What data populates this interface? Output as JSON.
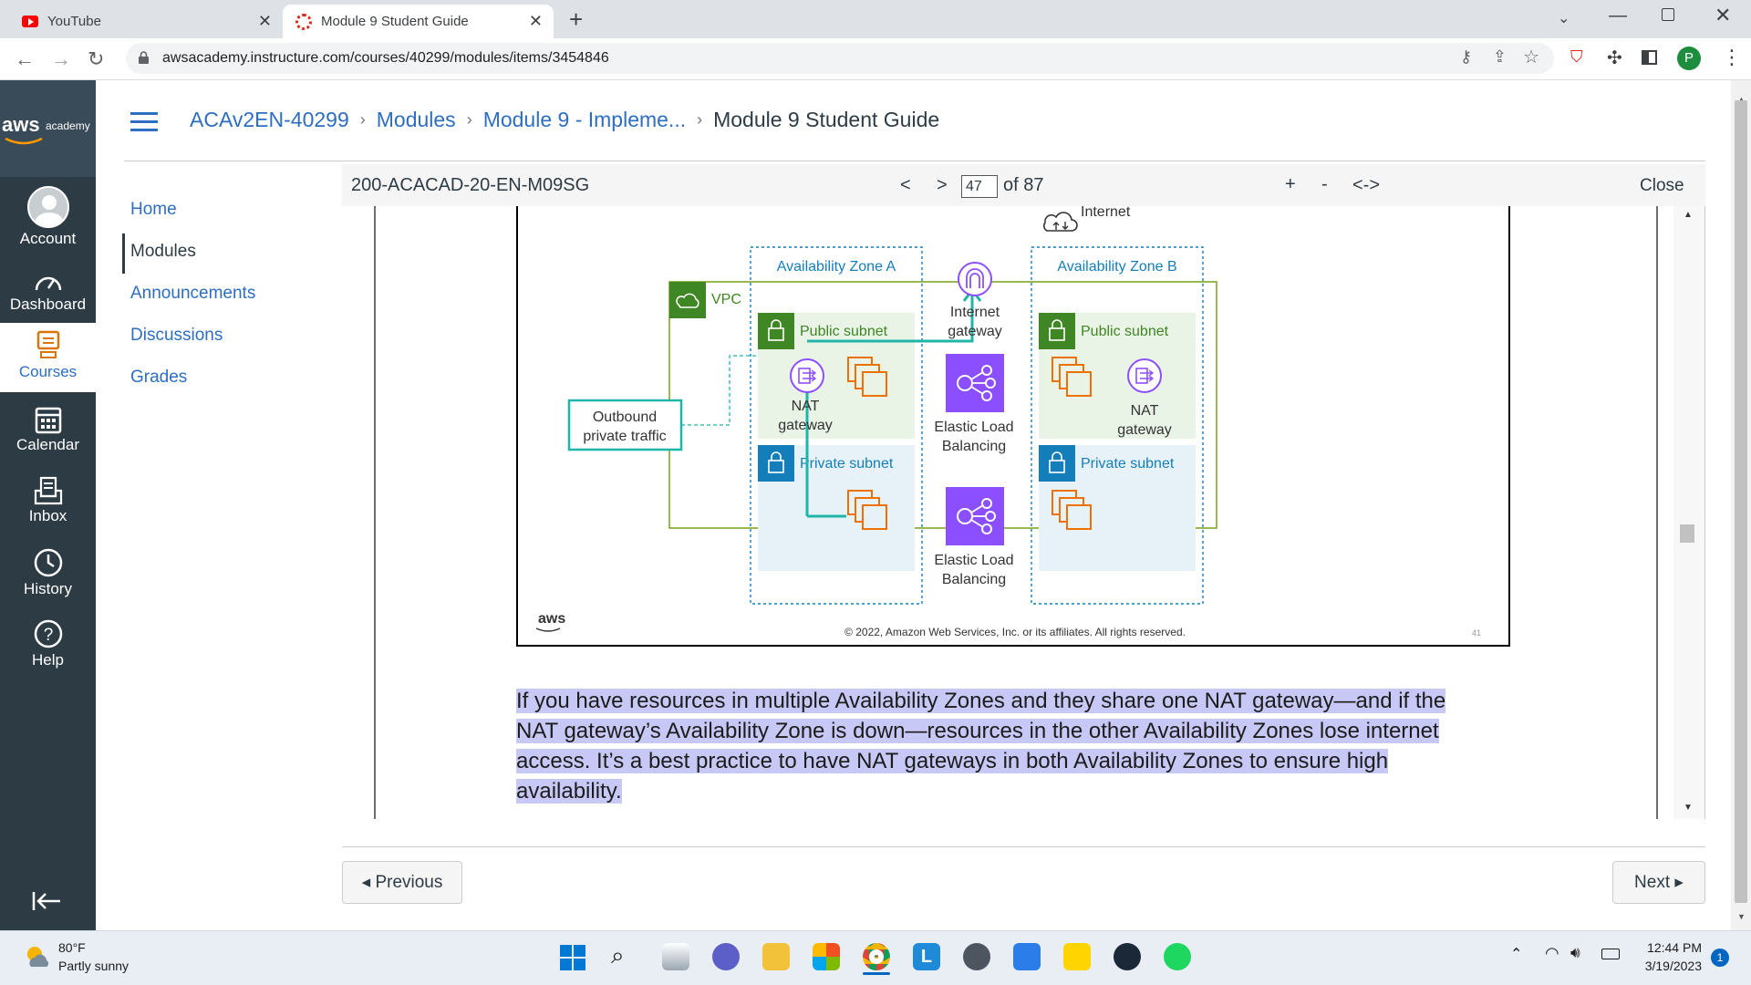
{
  "browser": {
    "tabs": [
      {
        "title": "YouTube",
        "active": false
      },
      {
        "title": "Module 9 Student Guide",
        "active": true
      }
    ],
    "url": "awsacademy.instructure.com/courses/40299/modules/items/3454846",
    "profile_initial": "P"
  },
  "global_nav": {
    "logo_text": "aws",
    "logo_sub": "academy",
    "items": [
      {
        "label": "Account",
        "icon": "account-icon"
      },
      {
        "label": "Dashboard",
        "icon": "dashboard-icon"
      },
      {
        "label": "Courses",
        "icon": "courses-icon"
      },
      {
        "label": "Calendar",
        "icon": "calendar-icon"
      },
      {
        "label": "Inbox",
        "icon": "inbox-icon"
      },
      {
        "label": "History",
        "icon": "history-icon"
      },
      {
        "label": "Help",
        "icon": "help-icon"
      }
    ]
  },
  "breadcrumb": [
    "ACAv2EN-40299",
    "Modules",
    "Module 9 - Impleme...",
    "Module 9 Student Guide"
  ],
  "course_nav": [
    "Home",
    "Modules",
    "Announcements",
    "Discussions",
    "Grades"
  ],
  "viewer": {
    "doc_id": "200-ACACAD-20-EN-M09SG",
    "prev": "<",
    "next": ">",
    "page": "47",
    "of_total": "of 87",
    "zoom_in": "+",
    "zoom_out": "-",
    "fit": "<->",
    "close": "Close"
  },
  "diagram": {
    "internet": "Internet",
    "vpc": "VPC",
    "az_a": "Availability Zone A",
    "az_b": "Availability Zone B",
    "internet_gateway": [
      "Internet",
      "gateway"
    ],
    "public_subnet": "Public subnet",
    "private_subnet": "Private subnet",
    "nat_gateway": [
      "NAT",
      "gateway"
    ],
    "elb": [
      "Elastic Load",
      "Balancing"
    ],
    "outbound": [
      "Outbound",
      "private traffic"
    ],
    "aws_logo": "aws",
    "copyright": "© 2022, Amazon Web Services, Inc. or its affiliates. All rights reserved.",
    "slide_number": "41"
  },
  "paragraph": [
    "If you have resources in multiple Availability Zones and they share one NAT gateway—and if the",
    "NAT gateway’s Availability Zone is down—resources in the other Availability Zones lose internet",
    "access. It’s a best practice to have NAT gateways in both Availability Zones to ensure high",
    "availability."
  ],
  "pager": {
    "previous": "◂ Previous",
    "next": "Next ▸"
  },
  "taskbar": {
    "weather_temp": "80°F",
    "weather_desc": "Partly sunny",
    "time": "12:44 PM",
    "date": "3/19/2023",
    "notification_count": "1"
  },
  "colors": {
    "canvas_nav": "#2d3b45",
    "link_blue": "#2d6ec3",
    "aws_green": "#3f8624",
    "aws_blue": "#147eba",
    "elb_purple": "#8c4fff",
    "ec2_orange": "#ed7100",
    "teal_route": "#1fb5a8",
    "highlight": "#c7c8f5"
  }
}
